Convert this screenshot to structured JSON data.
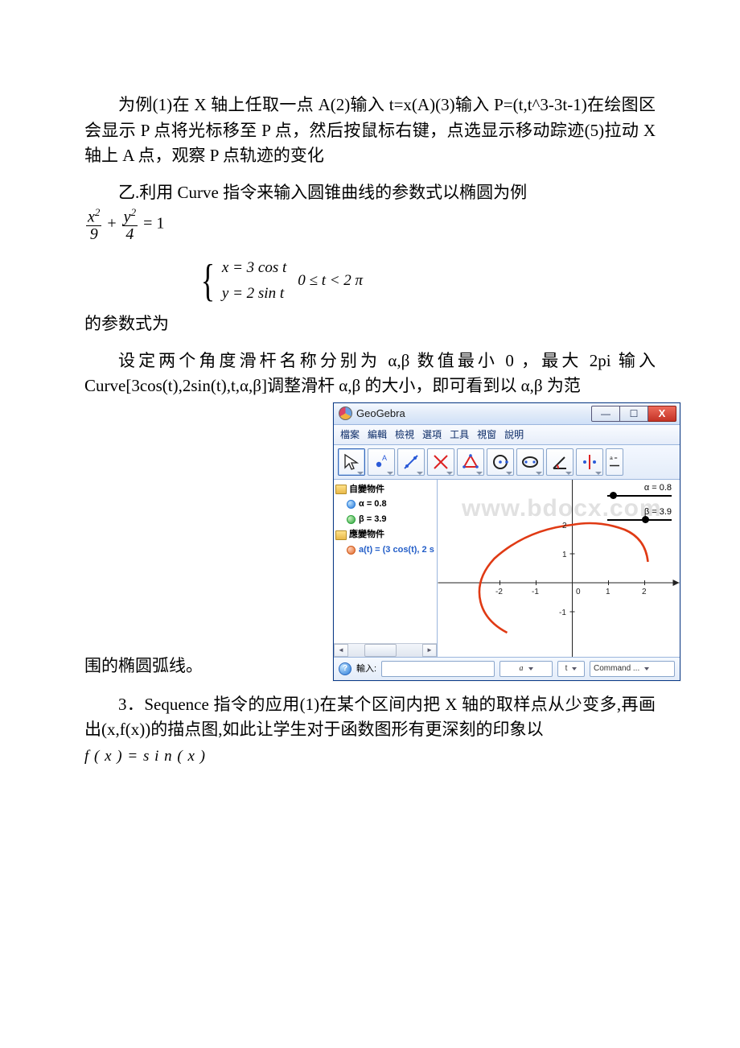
{
  "para1": "为例(1)在 X 轴上任取一点 A(2)输入 t=x(A)(3)输入 P=(t,t^3-3t-1)在绘图区会显示 P 点将光标移至 P 点，然后按鼠标右键，点选显示移动踪迹(5)拉动 X 轴上 A 点，观察 P 点轨迹的变化",
  "para2": "乙.利用 Curve 指令来输入圆锥曲线的参数式以椭圆为例",
  "formula1": {
    "f1n": "x",
    "f1d": "9",
    "f2n": "y",
    "f2d": "4",
    "sq": "2",
    "plus": "+",
    "eq1": "= 1"
  },
  "parametric": {
    "prefix": "的参数式为",
    "e1": "x = 3 cos  t",
    "e2": "y = 2 sin  t",
    "cond": "0 ≤ t < 2 π"
  },
  "para3": "设定两个角度滑杆名称分别为 α,β 数值最小 0 ，最大 2pi 输入 Curve[3cos(t),2sin(t),t,α,β]调整滑杆 α,β 的大小，即可看到以 α,β 为范",
  "tail": "围的椭圆弧线。",
  "para4_a": "3．Sequence 指令的应用(1)在某个区间内把 X 轴的取样点从少变多,再画出(x,f(x))的描点图,如此让学生对于函数图形有更深刻的印象以",
  "para4_formula": "f ( x ) = s i n ( x )",
  "ggb": {
    "title": "GeoGebra",
    "menus": [
      "檔案",
      "編輯",
      "檢視",
      "選項",
      "工具",
      "視窗",
      "說明"
    ],
    "tree": {
      "free": "自變物件",
      "alpha": "α = 0.8",
      "beta": "β = 3.9",
      "dep": "應變物件",
      "curve": "a(t) = (3 cos(t), 2 s"
    },
    "sliderA": "α = 0.8",
    "sliderB": "β = 3.9",
    "axis": {
      "m2": "-2",
      "m1": "-1",
      "z": "0",
      "p1": "1",
      "p2": "2",
      "yp1": "1",
      "yp2": "2",
      "ym1": "-1"
    },
    "input_label": "輸入:",
    "combo_a": "a",
    "combo_t": "t",
    "combo_cmd": "Command ...",
    "winbtns": {
      "min": "—",
      "max": "☐",
      "close": "X"
    },
    "watermark": "www.bdocx.com"
  }
}
